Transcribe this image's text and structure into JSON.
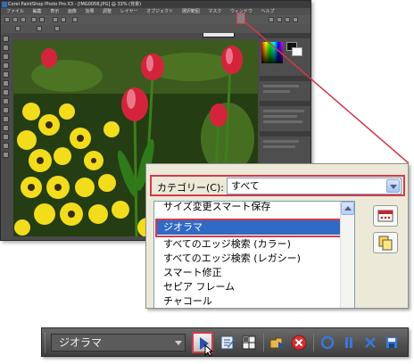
{
  "app": {
    "title": "Corel PaintShop Photo Pro X3 - [IMG0058.JPG] @ 33% (背景)",
    "menu": [
      "ファイル",
      "編集",
      "表示",
      "画像",
      "効果",
      "調整",
      "レイヤー",
      "オブジェクト",
      "選択範囲",
      "マスク",
      "ウィンドウ",
      "ヘルプ"
    ],
    "scripts_combo_label": "ジオラマ"
  },
  "dialog": {
    "category_label": "カテゴリー(C):",
    "category_value": "すべて",
    "scripts": [
      "サイズ変更スマート保存",
      "ジオラマ",
      "すべてのエッジ検索 (カラー)",
      "すべてのエッジ検索 (レガシー)",
      "スマート修正",
      "セピア フレーム",
      "チャコール"
    ],
    "selected_index": 1
  },
  "toolbar": {
    "script_value": "ジオラマ"
  },
  "colors": {
    "highlight": "#d23a4a",
    "selection": "#316ac5"
  },
  "icons": [
    "folder-icon",
    "pencil-script-icon",
    "grid-icon",
    "play-icon",
    "edit-script-icon",
    "panel-icon",
    "open-run-icon",
    "stop-icon",
    "record-icon",
    "pause-icon",
    "cancel-icon",
    "save-icon"
  ]
}
